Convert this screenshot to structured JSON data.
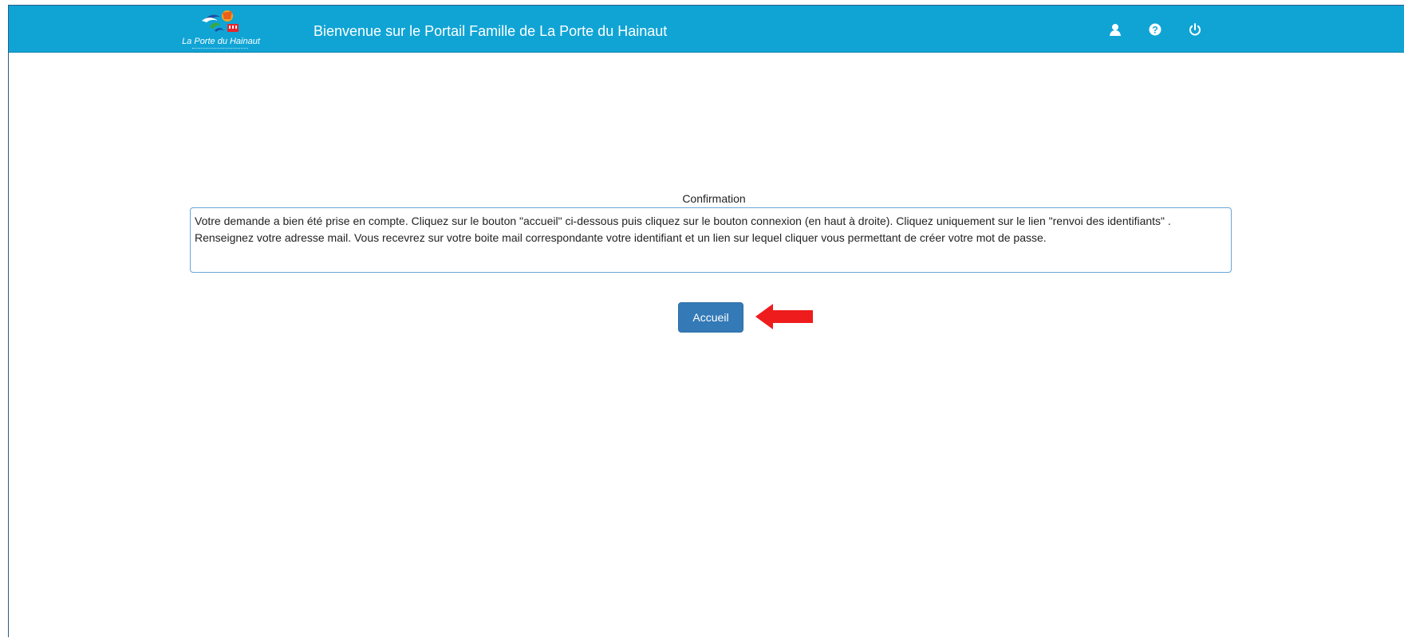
{
  "header": {
    "logo_text": "La Porte du Hainaut",
    "title": "Bienvenue sur le Portail Famille de La Porte du Hainaut",
    "icons": [
      "user-icon",
      "help-icon",
      "power-icon"
    ]
  },
  "confirmation": {
    "title": "Confirmation",
    "message": "Votre demande a bien été prise en compte. Cliquez sur le bouton \"accueil\" ci-dessous puis cliquez sur le bouton connexion (en haut à droite). Cliquez uniquement sur le lien \"renvoi des identifiants\" . Renseignez votre adresse mail. Vous recevrez sur votre boite mail correspondante votre identifiant et un lien sur lequel cliquer vous permettant de créer votre mot de passe.",
    "button_label": "Accueil"
  },
  "colors": {
    "header_bg": "#10a4d5",
    "button_bg": "#337ab7",
    "box_border": "#6aa6d8",
    "arrow": "#ee1c1c"
  }
}
